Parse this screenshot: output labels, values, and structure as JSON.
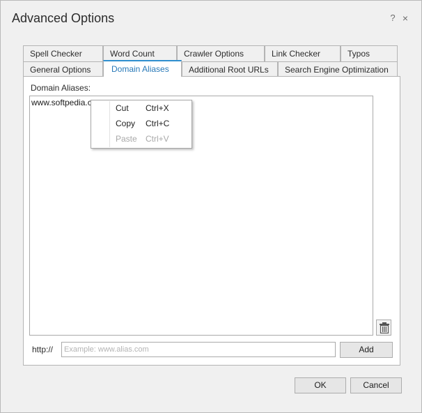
{
  "window": {
    "title": "Advanced Options",
    "help_glyph": "?",
    "close_glyph": "×"
  },
  "tabs": {
    "row1": [
      "Spell Checker",
      "Word Count",
      "Crawler Options",
      "Link Checker",
      "Typos"
    ],
    "row2": [
      "General Options",
      "Domain Aliases",
      "Additional Root URLs",
      "Search Engine Optimization"
    ],
    "active": "Domain Aliases"
  },
  "panel": {
    "label": "Domain Aliases:",
    "aliases": [
      "www.softpedia.com"
    ],
    "http_prefix": "http://",
    "input_value": "",
    "input_placeholder": "Example: www.alias.com",
    "add_label": "Add"
  },
  "context_menu": {
    "items": [
      {
        "label": "Cut",
        "shortcut": "Ctrl+X",
        "enabled": true
      },
      {
        "label": "Copy",
        "shortcut": "Ctrl+C",
        "enabled": true
      },
      {
        "label": "Paste",
        "shortcut": "Ctrl+V",
        "enabled": false
      }
    ]
  },
  "footer": {
    "ok_label": "OK",
    "cancel_label": "Cancel"
  }
}
